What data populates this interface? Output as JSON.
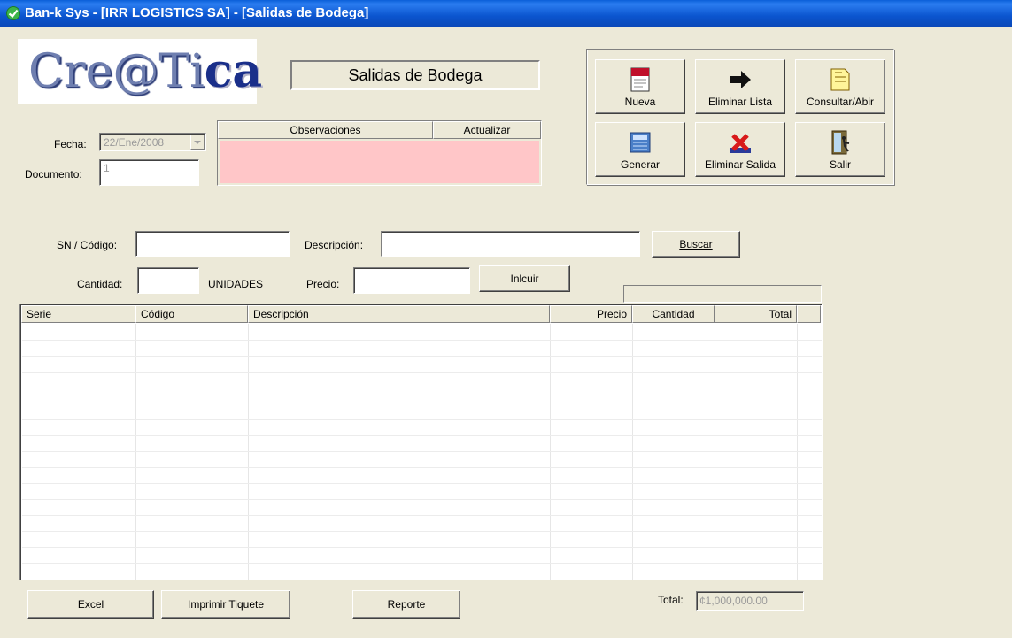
{
  "window": {
    "title": "Ban-k Sys - [IRR LOGISTICS SA] - [Salidas de Bodega]"
  },
  "logo": {
    "part1": "Cre@Ti",
    "part2": "ca"
  },
  "form": {
    "title": "Salidas de Bodega",
    "fecha_label": "Fecha:",
    "fecha_value": "22/Ene/2008",
    "documento_label": "Documento:",
    "documento_value": "1",
    "observaciones_label": "Observaciones",
    "actualizar_label": "Actualizar",
    "observaciones_value": ""
  },
  "toolbar": {
    "nueva": "Nueva",
    "eliminar_lista": "Eliminar Lista",
    "consultar": "Consultar/Abir",
    "generar": "Generar",
    "eliminar_salida": "Eliminar Salida",
    "salir": "Salir"
  },
  "entry": {
    "sn_label": "SN / Código:",
    "sn_value": "",
    "descripcion_label": "Descripción:",
    "descripcion_value": "",
    "buscar_label": "Buscar",
    "cantidad_label": "Cantidad:",
    "cantidad_value": "",
    "unidades_label": "UNIDADES",
    "precio_label": "Precio:",
    "precio_value": "",
    "incluir_label": "Inlcuir"
  },
  "table": {
    "columns": [
      "Serie",
      "Código",
      "Descripción",
      "Precio",
      "Cantidad",
      "Total"
    ],
    "rows": []
  },
  "footer": {
    "excel": "Excel",
    "imprimir": "Imprimir Tiquete",
    "reporte": "Reporte",
    "total_label": "Total:",
    "total_value": "¢1,000,000.00"
  },
  "colors": {
    "titlebar": "#0a5fd8",
    "observaciones_bg": "#ffc6c8",
    "window_bg": "#ece9d8"
  },
  "icons": {
    "app": "check-icon",
    "nueva": "new-document-icon",
    "eliminar_lista": "arrow-right-icon",
    "consultar": "open-document-icon",
    "generar": "calculator-icon",
    "eliminar_salida": "red-x-icon",
    "salir": "exit-door-icon"
  }
}
